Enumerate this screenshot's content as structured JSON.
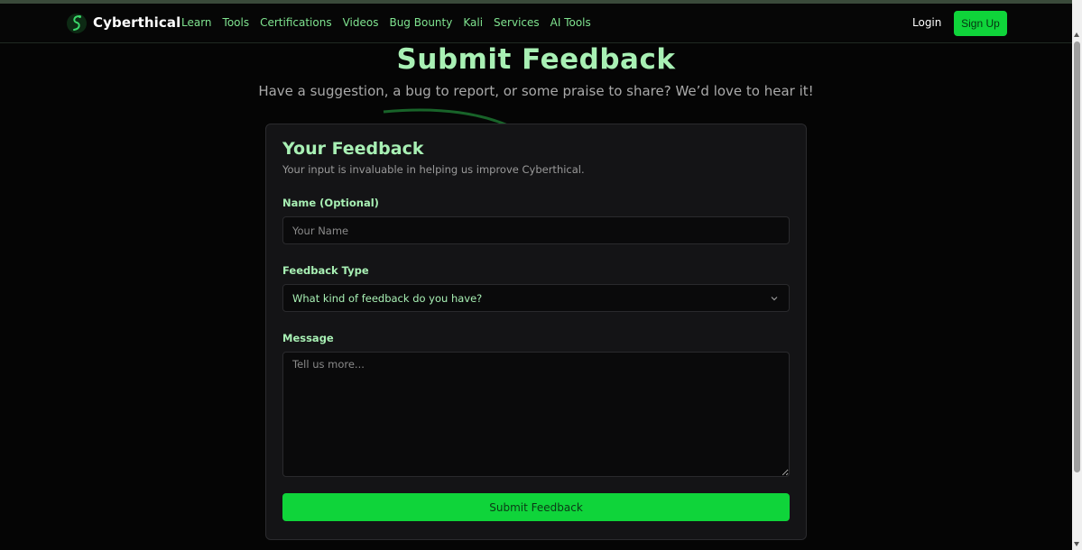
{
  "nav": {
    "brand": "Cyberthical",
    "links": [
      "Learn",
      "Tools",
      "Certifications",
      "Videos",
      "Bug Bounty",
      "Kali",
      "Services",
      "AI Tools"
    ],
    "login": "Login",
    "signup": "Sign Up"
  },
  "hero": {
    "title": "Submit Feedback",
    "subtitle": "Have a suggestion, a bug to report, or some praise to share? We’d love to hear it!"
  },
  "form": {
    "title": "Your Feedback",
    "subtitle": "Your input is invaluable in helping us improve Cyberthical.",
    "name_label": "Name (Optional)",
    "name_placeholder": "Your Name",
    "type_label": "Feedback Type",
    "type_selected": "What kind of feedback do you have?",
    "message_label": "Message",
    "message_placeholder": "Tell us more...",
    "submit_label": "Submit Feedback"
  },
  "colors": {
    "accent": "#0fd43a",
    "accent_text": "#a8f0b4",
    "nav_link": "#7fe38f",
    "background": "#050505",
    "card": "#141416"
  },
  "icons": {
    "logo": "snake-logo-icon",
    "select": "chevron-down-icon"
  }
}
